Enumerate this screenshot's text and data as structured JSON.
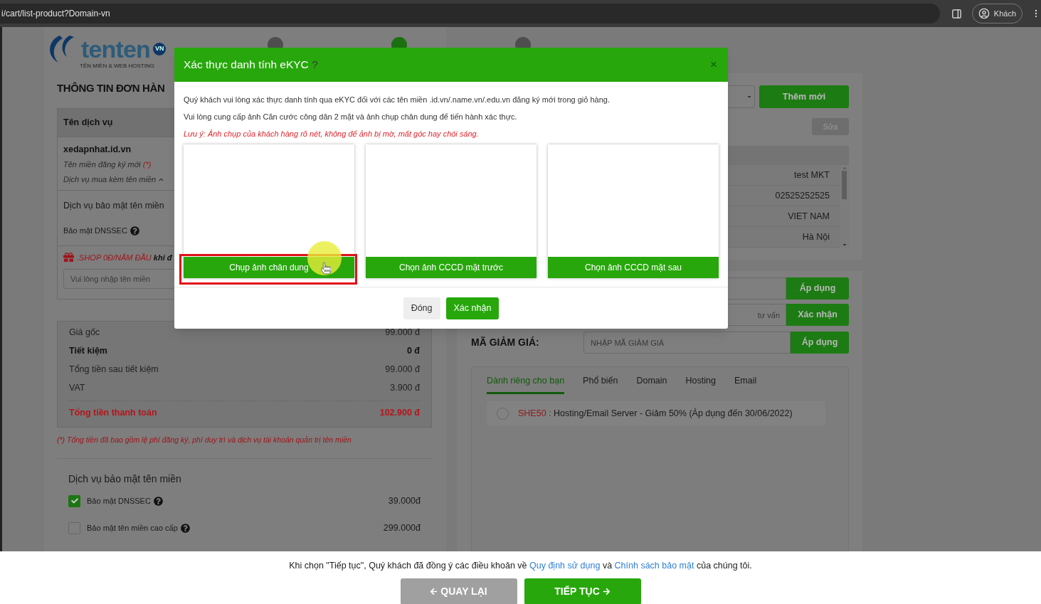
{
  "browser": {
    "url": "i/cart/list-product?Domain-vn",
    "profile_label": "Khách"
  },
  "logo": {
    "text": "tenten",
    "badge": "VN",
    "tagline": "TÊN MIỀN & WEB HOSTING"
  },
  "steps": [
    {
      "selected": false
    },
    {
      "selected": true
    },
    {
      "selected": false
    }
  ],
  "order": {
    "title": "THÔNG TIN ĐƠN HÀN",
    "table_header": "Tên dịch vụ",
    "domain": {
      "name": "xedapnhat.id.vn",
      "type_label": "Tên miền đăng ký mới",
      "type_mark": "(*)",
      "addon_toggle": "Dịch vụ mua kèm tên miền",
      "expanded": true
    },
    "security_heading": "Dịch vụ bảo mật tên miền",
    "security_item": "Bảo mật DNSSEC",
    "promo": {
      "label": ".SHOP 0Đ/NĂM ĐẦU",
      "tail": "khi đ"
    },
    "domain_input": {
      "placeholder": "Vui lòng nhập tên miền"
    }
  },
  "summary": [
    {
      "kind": "normal",
      "label": "Giá gốc",
      "value": "99.000 đ"
    },
    {
      "kind": "bold",
      "label": "Tiết kiệm",
      "value": "0 đ"
    },
    {
      "kind": "normal",
      "label": "Tổng tiền sau tiết kiệm",
      "value": "99.000 đ"
    },
    {
      "kind": "normal",
      "label": "VAT",
      "value": "3.900 đ"
    },
    {
      "kind": "total",
      "label": "Tổng tiền thanh toán",
      "value": "102.900 đ"
    }
  ],
  "note": "(*) Tổng tiền đã bao gồm lệ phí đăng ký, phí duy trì và dịch vụ tài khoản quản trị tên miền",
  "security": {
    "heading": "Dịch vụ bảo mật tên miền",
    "options": [
      {
        "label": "Bảo mật DNSSEC",
        "price": "39.000đ",
        "checked": true
      },
      {
        "label": "Bảo mật tên miền cao cấp",
        "price": "299.000đ",
        "checked": false
      }
    ]
  },
  "contact": {
    "add_button": "Thêm mới",
    "edit_button": "Sửa",
    "rows": [
      "test MKT",
      "02525252525",
      "VIET NAM",
      "Hà Nội"
    ]
  },
  "actions": [
    {
      "button": "Áp dụng"
    },
    {
      "placeholder": "tư vấn",
      "button": "Xác nhận"
    }
  ],
  "coupon": {
    "label": "MÃ GIẢM GIÁ:",
    "placeholder": "NHẬP MÃ GIẢM GIÁ",
    "button": "Áp dụng",
    "tabs": [
      {
        "label": "Dành riêng cho bạn",
        "selected": true
      },
      {
        "label": "Phổ biến",
        "selected": false
      },
      {
        "label": "Domain",
        "selected": false
      },
      {
        "label": "Hosting",
        "selected": false
      },
      {
        "label": "Email",
        "selected": false
      }
    ],
    "offers": [
      {
        "code": "SHE50 :",
        "text": "Hosting/Email Server - Giảm 50% (Áp dụng đến 30/06/2022)",
        "selected": false
      }
    ]
  },
  "modal": {
    "title": "Xác thực danh tính eKYC",
    "help": "?",
    "close": "×",
    "lines": [
      "Quý khách vui lòng xác thực danh tính qua eKYC đối với các tên miền .id.vn/.name.vn/.edu.vn đăng ký mới trong giỏ hàng.",
      "Vui lòng cung cấp ảnh Căn cước công dân 2 mặt và ảnh chụp chân dung để tiến hành xác thực."
    ],
    "warning": "Lưu ý: Ảnh chụp của khách hàng rõ nét, không để ảnh bị mờ, mất góc hay chói sáng.",
    "slots": [
      {
        "button": "Chụp ảnh chân dung",
        "highlighted": true
      },
      {
        "button": "Chọn ảnh CCCD mặt trước",
        "highlighted": false
      },
      {
        "button": "Chọn ảnh CCCD mặt sau",
        "highlighted": false
      }
    ],
    "cancel": "Đóng",
    "confirm": "Xác nhận"
  },
  "footer": {
    "before": "Khi chọn \"Tiếp tục\", Quý khách đã đồng ý các điều khoản về ",
    "link1": "Quy định sử dụng",
    "middle": " và ",
    "link2": "Chính sách bảo mật",
    "after": " của chúng tôi.",
    "back": "QUAY LẠI",
    "next": "TIẾP TỤC"
  }
}
